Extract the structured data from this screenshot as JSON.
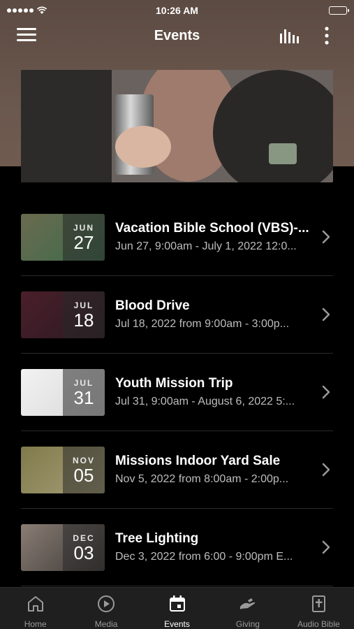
{
  "status_bar": {
    "time": "10:26 AM"
  },
  "header": {
    "title": "Events"
  },
  "hero": {
    "image": "hero-photo"
  },
  "events": [
    {
      "month": "JUN",
      "day": "27",
      "title": "Vacation Bible School (VBS)-...",
      "subtitle": "Jun 27, 9:00am - July 1, 2022 12:0...",
      "thumb": "#6b6a4f",
      "thumb2": "#3b6c4b"
    },
    {
      "month": "JUL",
      "day": "18",
      "title": "Blood Drive",
      "subtitle": "Jul 18, 2022 from 9:00am - 3:00p...",
      "thumb": "#4a1f2b",
      "thumb2": "#2a1a22"
    },
    {
      "month": "JUL",
      "day": "31",
      "title": "Youth Mission Trip",
      "subtitle": "Jul 31, 9:00am - August 6, 2022 5:...",
      "thumb": "#f2f2f2",
      "thumb2": "#d8d8d8"
    },
    {
      "month": "NOV",
      "day": "05",
      "title": "Missions Indoor Yard Sale",
      "subtitle": "Nov 5, 2022 from 8:00am - 2:00p...",
      "thumb": "#7f7a4a",
      "thumb2": "#a89f7a"
    },
    {
      "month": "DEC",
      "day": "03",
      "title": "Tree Lighting",
      "subtitle": "Dec 3, 2022 from 6:00 - 9:00pm E...",
      "thumb": "#8a7d74",
      "thumb2": "#3b3836"
    }
  ],
  "tabs": [
    {
      "label": "Home",
      "icon": "home-icon",
      "active": false
    },
    {
      "label": "Media",
      "icon": "play-icon",
      "active": false
    },
    {
      "label": "Events",
      "icon": "calendar-icon",
      "active": true
    },
    {
      "label": "Giving",
      "icon": "giving-hand-icon",
      "active": false
    },
    {
      "label": "Audio Bible",
      "icon": "bible-icon",
      "active": false
    }
  ]
}
